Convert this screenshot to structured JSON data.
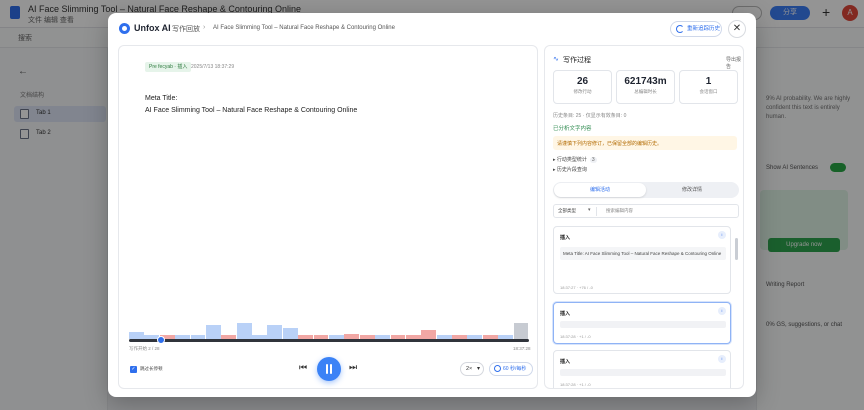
{
  "bg": {
    "doc_title": "AI Face Slimming Tool – Natural Face Reshape & Contouring Online",
    "menu": "文件   编辑   查看",
    "search": "搜索",
    "share_label": "分享",
    "avatar_initial": "A",
    "sidebar_label": "文档结构",
    "tabs": [
      "Tab 1",
      "Tab 2"
    ],
    "right_note": "9% AI probability. We are highly confident this text is entirely human.",
    "right_option": "Show AI Sentences",
    "upgrade_label": "Upgrade now",
    "writing_report": "Writing Report",
    "suggestions": "0% GS, suggestions, or chat"
  },
  "header": {
    "brand": "Unfox AI",
    "section": "写作回放",
    "doc_title": "AI Face Slimming Tool – Natural Face Reshape & Contouring Online",
    "refresh_label": "重新追踪历史",
    "close_label": "✕"
  },
  "document": {
    "badge": "Pre fecyab · 插入",
    "timestamp": "2025/7/13 18:37:29",
    "line1": "Meta Title:",
    "line2": "AI Face Slimming Tool – Natural Face Reshape & Contouring Online"
  },
  "playback": {
    "start_label": "写作开始 2 / 28",
    "end_label": "18:37:28",
    "progress": 0.08,
    "checkbox_label": "跳过长停顿",
    "speed": "2×",
    "speed_btn": "60 秒/每秒"
  },
  "side": {
    "title": "写作过程",
    "link": "导出报告",
    "stats": [
      {
        "value": "26",
        "label": "修改行动"
      },
      {
        "value": "621743m",
        "label": "总编辑时长"
      },
      {
        "value": "1",
        "label": "会话窗口"
      }
    ],
    "meta_line": "历史条目: 25 · 仅显示有效条目: 0",
    "analyzed": "已分析文字内容",
    "warning": "请谨慎下列内容修订，已保留全部的编辑历史。",
    "collapse1": "▸ 行动类型统计",
    "collapse1_count": "3",
    "collapse2": "▸ 历史片段查询",
    "tab_active": "编辑活动",
    "tab_inactive": "修改详情",
    "filter_select": "全部类型",
    "filter_placeholder": "搜索编辑内容",
    "cards": [
      {
        "type": "插入",
        "text": "Meta Title: AI Face Slimming Tool – Natural Face Reshape & Contouring Online",
        "meta": "18:37:27 · +76 / -0"
      },
      {
        "type": "插入",
        "text": "",
        "meta": "18:37:28 · +1 / -0"
      },
      {
        "type": "插入",
        "text": "",
        "meta": "18:37:28 · +1 / -0"
      }
    ]
  },
  "timeline_data": {
    "segments": [
      {
        "value": 0.4,
        "kind": "add"
      },
      {
        "value": 0.2,
        "kind": "add"
      },
      {
        "value": 0.2,
        "kind": "del"
      },
      {
        "value": 0.2,
        "kind": "add"
      },
      {
        "value": 0.2,
        "kind": "add"
      },
      {
        "value": 0.8,
        "kind": "add"
      },
      {
        "value": 0.2,
        "kind": "del"
      },
      {
        "value": 0.9,
        "kind": "add"
      },
      {
        "value": 0.2,
        "kind": "add"
      },
      {
        "value": 0.8,
        "kind": "add"
      },
      {
        "value": 0.6,
        "kind": "add"
      },
      {
        "value": 0.2,
        "kind": "del"
      },
      {
        "value": 0.2,
        "kind": "del"
      },
      {
        "value": 0.2,
        "kind": "add"
      },
      {
        "value": 0.3,
        "kind": "del"
      },
      {
        "value": 0.2,
        "kind": "del"
      },
      {
        "value": 0.2,
        "kind": "add"
      },
      {
        "value": 0.2,
        "kind": "del"
      },
      {
        "value": 0.2,
        "kind": "del"
      },
      {
        "value": 0.5,
        "kind": "del"
      },
      {
        "value": 0.2,
        "kind": "add"
      },
      {
        "value": 0.2,
        "kind": "del"
      },
      {
        "value": 0.2,
        "kind": "add"
      },
      {
        "value": 0.2,
        "kind": "del"
      },
      {
        "value": 0.2,
        "kind": "add"
      },
      {
        "value": 0.9,
        "kind": "neutral"
      }
    ],
    "colors": {
      "add": "#b9d1f7",
      "del": "#f1a7a4",
      "neutral": "#c7cbd2"
    }
  }
}
